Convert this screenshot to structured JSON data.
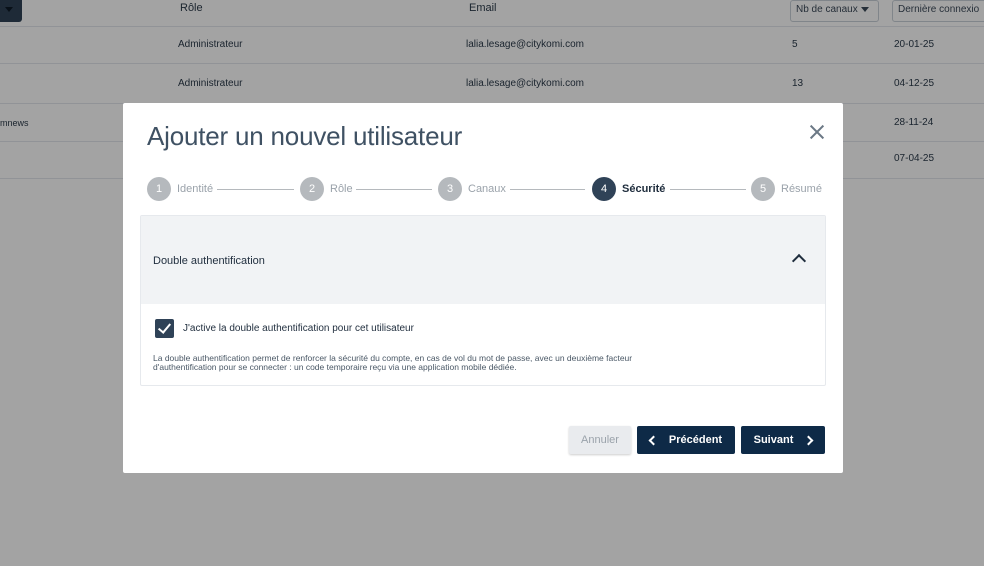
{
  "table": {
    "headers": {
      "role": "Rôle",
      "email": "Email",
      "nb_canaux": "Nb de canaux",
      "derniere_connexion": "Dernière connexio"
    },
    "rows": [
      {
        "col1": "",
        "role": "Administrateur",
        "email": "lalia.lesage@citykomi.com",
        "nb": "5",
        "date": "20-01-25"
      },
      {
        "col1": "",
        "role": "Administrateur",
        "email": "lalia.lesage@citykomi.com",
        "nb": "13",
        "date": "04-12-25"
      },
      {
        "col1": "mnews",
        "role": "",
        "email": "",
        "nb": "",
        "date": "28-11-24"
      },
      {
        "col1": "",
        "role": "",
        "email": "",
        "nb": "",
        "date": "07-04-25"
      }
    ]
  },
  "modal": {
    "title": "Ajouter un nouvel utilisateur",
    "steps": [
      {
        "number": "1",
        "label": "Identité",
        "active": false
      },
      {
        "number": "2",
        "label": "Rôle",
        "active": false
      },
      {
        "number": "3",
        "label": "Canaux",
        "active": false
      },
      {
        "number": "4",
        "label": "Sécurité",
        "active": true
      },
      {
        "number": "5",
        "label": "Résumé",
        "active": false
      }
    ],
    "panel": {
      "title": "Double authentification",
      "checkbox_label": "J'active la double authentification pour cet utilisateur",
      "checkbox_checked": true,
      "help_line1": "La double authentification permet de renforcer la sécurité du compte, en cas de vol du mot de passe, avec un deuxième facteur",
      "help_line2": "d'authentification pour se connecter : un code temporaire reçu via une application mobile dédiée."
    },
    "buttons": {
      "cancel": "Annuler",
      "previous": "Précédent",
      "next": "Suivant"
    }
  },
  "colors": {
    "primary": "#0e2a47",
    "step_active": "#2f4257",
    "step_inactive": "#b5b9bd"
  }
}
